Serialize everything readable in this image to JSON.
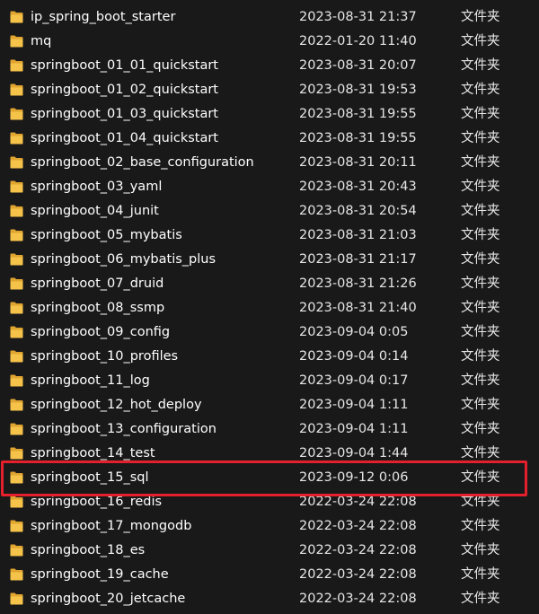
{
  "columns": [
    "name",
    "date",
    "type"
  ],
  "colors": {
    "background": "#191919",
    "folder_front": "#f5c24a",
    "folder_back": "#e0a530",
    "highlight_border": "#e3202b"
  },
  "folder_icon": "folder-icon",
  "highlighted_index": 18,
  "rows": [
    {
      "name": "ip_spring_boot_starter",
      "date": "2023-08-31 21:37",
      "type": "文件夹"
    },
    {
      "name": "mq",
      "date": "2022-01-20 11:40",
      "type": "文件夹"
    },
    {
      "name": "springboot_01_01_quickstart",
      "date": "2023-08-31 20:07",
      "type": "文件夹"
    },
    {
      "name": "springboot_01_02_quickstart",
      "date": "2023-08-31 19:53",
      "type": "文件夹"
    },
    {
      "name": "springboot_01_03_quickstart",
      "date": "2023-08-31 19:55",
      "type": "文件夹"
    },
    {
      "name": "springboot_01_04_quickstart",
      "date": "2023-08-31 19:55",
      "type": "文件夹"
    },
    {
      "name": "springboot_02_base_configuration",
      "date": "2023-08-31 20:11",
      "type": "文件夹"
    },
    {
      "name": "springboot_03_yaml",
      "date": "2023-08-31 20:43",
      "type": "文件夹"
    },
    {
      "name": "springboot_04_junit",
      "date": "2023-08-31 20:54",
      "type": "文件夹"
    },
    {
      "name": "springboot_05_mybatis",
      "date": "2023-08-31 21:03",
      "type": "文件夹"
    },
    {
      "name": "springboot_06_mybatis_plus",
      "date": "2023-08-31 21:17",
      "type": "文件夹"
    },
    {
      "name": "springboot_07_druid",
      "date": "2023-08-31 21:26",
      "type": "文件夹"
    },
    {
      "name": "springboot_08_ssmp",
      "date": "2023-08-31 21:40",
      "type": "文件夹"
    },
    {
      "name": "springboot_09_config",
      "date": "2023-09-04 0:05",
      "type": "文件夹"
    },
    {
      "name": "springboot_10_profiles",
      "date": "2023-09-04 0:14",
      "type": "文件夹"
    },
    {
      "name": "springboot_11_log",
      "date": "2023-09-04 0:17",
      "type": "文件夹"
    },
    {
      "name": "springboot_12_hot_deploy",
      "date": "2023-09-04 1:11",
      "type": "文件夹"
    },
    {
      "name": "springboot_13_configuration",
      "date": "2023-09-04 1:11",
      "type": "文件夹"
    },
    {
      "name": "springboot_14_test",
      "date": "2023-09-04 1:44",
      "type": "文件夹"
    },
    {
      "name": "springboot_15_sql",
      "date": "2023-09-12 0:06",
      "type": "文件夹"
    },
    {
      "name": "springboot_16_redis",
      "date": "2022-03-24 22:08",
      "type": "文件夹"
    },
    {
      "name": "springboot_17_mongodb",
      "date": "2022-03-24 22:08",
      "type": "文件夹"
    },
    {
      "name": "springboot_18_es",
      "date": "2022-03-24 22:08",
      "type": "文件夹"
    },
    {
      "name": "springboot_19_cache",
      "date": "2022-03-24 22:08",
      "type": "文件夹"
    },
    {
      "name": "springboot_20_jetcache",
      "date": "2022-03-24 22:08",
      "type": "文件夹"
    }
  ]
}
